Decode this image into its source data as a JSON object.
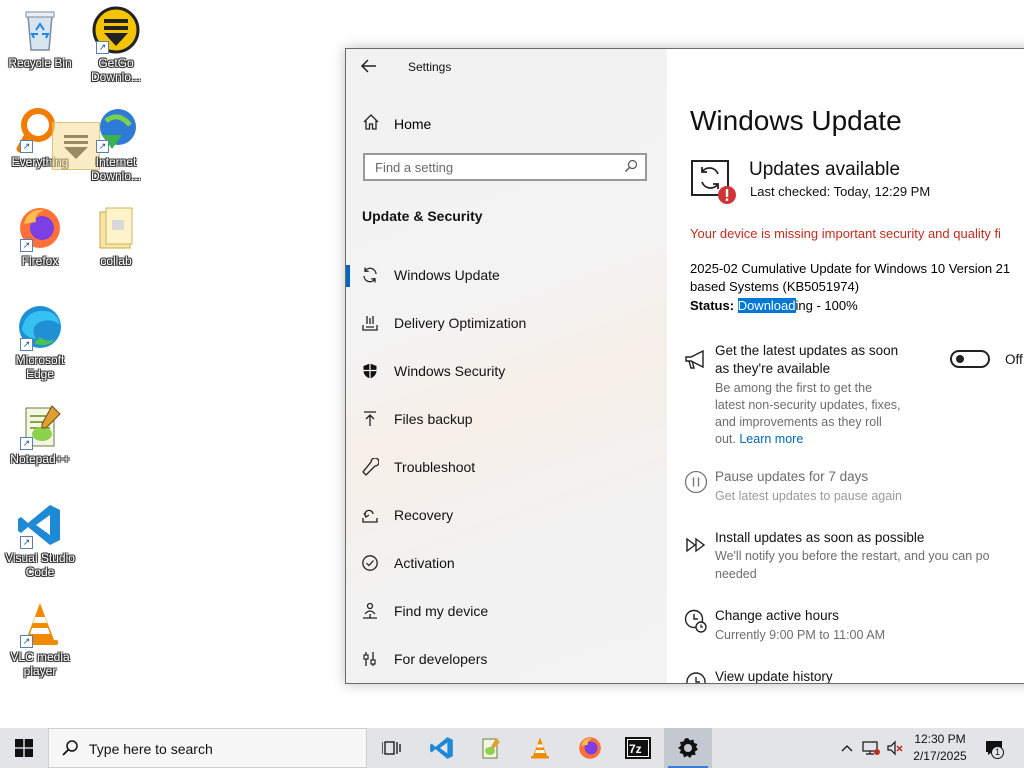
{
  "desktop": {
    "icons": [
      {
        "label": "Recycle Bin"
      },
      {
        "label": "GetGo Downlo..."
      },
      {
        "label": "Everything"
      },
      {
        "label": "Internet Downlo..."
      },
      {
        "label": "Firefox"
      },
      {
        "label": "collab"
      },
      {
        "label": "Microsoft Edge"
      },
      {
        "label": "Notepad++"
      },
      {
        "label": "Visual Studio Code"
      },
      {
        "label": "VLC media player"
      }
    ]
  },
  "window": {
    "title": "Settings",
    "home_label": "Home",
    "search_placeholder": "Find a setting",
    "section_title": "Update & Security",
    "nav_items": [
      {
        "label": "Windows Update",
        "icon": "sync-icon",
        "active": true
      },
      {
        "label": "Delivery Optimization",
        "icon": "delivery-icon"
      },
      {
        "label": "Windows Security",
        "icon": "shield-icon"
      },
      {
        "label": "Files backup",
        "icon": "backup-icon"
      },
      {
        "label": "Troubleshoot",
        "icon": "wrench-icon"
      },
      {
        "label": "Recovery",
        "icon": "recovery-icon"
      },
      {
        "label": "Activation",
        "icon": "check-circle-icon"
      },
      {
        "label": "Find my device",
        "icon": "person-pin-icon"
      },
      {
        "label": "For developers",
        "icon": "sliders-icon"
      }
    ]
  },
  "update": {
    "page_title": "Windows Update",
    "status_title": "Updates available",
    "last_checked": "Last checked: Today, 12:29 PM",
    "warning": "Your device is missing important security and quality fi",
    "kb_line1": "2025-02 Cumulative Update for Windows 10 Version 21",
    "kb_line2": "based Systems (KB5051974)",
    "status_label": "Status:",
    "status_selected": "Download",
    "status_rest": "ing - 100%",
    "options": {
      "latest": {
        "title1": "Get the latest updates as soon",
        "title2": "as they're available",
        "desc1": "Be among the first to get the",
        "desc2": "latest non-security updates, fixes,",
        "desc3": "and improvements as they roll",
        "desc4": "out.",
        "link": "Learn more",
        "toggle_label": "Off"
      },
      "pause": {
        "title": "Pause updates for 7 days",
        "desc": "Get latest updates to pause again"
      },
      "install": {
        "title": "Install updates as soon as possible",
        "desc1": "We'll notify you before the restart, and you can po",
        "desc2": "needed"
      },
      "hours": {
        "title": "Change active hours",
        "desc": "Currently 9:00 PM to 11:00 AM"
      },
      "history": {
        "title": "View update history"
      }
    }
  },
  "taskbar": {
    "search_placeholder": "Type here to search",
    "time": "12:30 PM",
    "date": "2/17/2025",
    "notification_count": "1"
  }
}
